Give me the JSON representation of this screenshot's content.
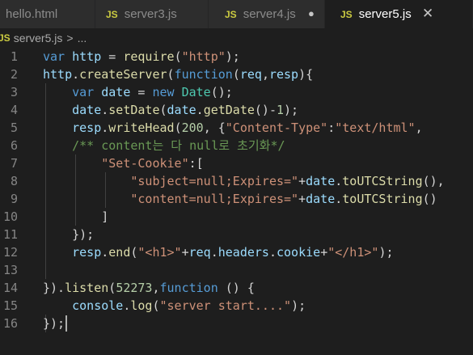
{
  "tabs": [
    {
      "label": "hello.html",
      "badge": "",
      "icon": "html-file-icon",
      "state": "inactive"
    },
    {
      "label": "server3.js",
      "badge": "JS",
      "icon": "js-file-icon",
      "state": "inactive"
    },
    {
      "label": "server4.js",
      "badge": "JS",
      "icon": "js-file-icon",
      "state": "inactive-modified",
      "indicator": "●"
    },
    {
      "label": "server5.js",
      "badge": "JS",
      "icon": "js-file-icon",
      "state": "active",
      "indicator": "✕"
    }
  ],
  "breadcrumb": {
    "badge": "JS",
    "file": "server5.js",
    "separator": ">",
    "more": "..."
  },
  "colors": {
    "editor_bg": "#1e1e1e",
    "tab_bar_bg": "#252526",
    "tab_inactive_bg": "#2d2d2d",
    "keyword": "#569cd6",
    "variable": "#9cdcfe",
    "function": "#dcdcaa",
    "string": "#ce9178",
    "number": "#b5cea8",
    "comment": "#6a9955",
    "js_badge": "#cbcb41"
  },
  "editor": {
    "line_numbers": [
      "1",
      "2",
      "3",
      "4",
      "5",
      "6",
      "7",
      "8",
      "9",
      "10",
      "11",
      "12",
      "13",
      "14",
      "15",
      "16"
    ],
    "lines": [
      [
        [
          "k",
          "var"
        ],
        [
          "p",
          " "
        ],
        [
          "v",
          "http"
        ],
        [
          "p",
          " = "
        ],
        [
          "f",
          "require"
        ],
        [
          "p",
          "("
        ],
        [
          "s",
          "\"http\""
        ],
        [
          "p",
          ");"
        ]
      ],
      [
        [
          "v",
          "http"
        ],
        [
          "p",
          "."
        ],
        [
          "f",
          "createServer"
        ],
        [
          "p",
          "("
        ],
        [
          "k",
          "function"
        ],
        [
          "p",
          "("
        ],
        [
          "v",
          "req"
        ],
        [
          "p",
          ","
        ],
        [
          "v",
          "resp"
        ],
        [
          "p",
          "){"
        ]
      ],
      [
        [
          "p",
          "    "
        ],
        [
          "k",
          "var"
        ],
        [
          "p",
          " "
        ],
        [
          "v",
          "date"
        ],
        [
          "p",
          " = "
        ],
        [
          "k",
          "new"
        ],
        [
          "p",
          " "
        ],
        [
          "t",
          "Date"
        ],
        [
          "p",
          "();"
        ]
      ],
      [
        [
          "p",
          "    "
        ],
        [
          "v",
          "date"
        ],
        [
          "p",
          "."
        ],
        [
          "f",
          "setDate"
        ],
        [
          "p",
          "("
        ],
        [
          "v",
          "date"
        ],
        [
          "p",
          "."
        ],
        [
          "f",
          "getDate"
        ],
        [
          "p",
          "()-"
        ],
        [
          "n",
          "1"
        ],
        [
          "p",
          ");"
        ]
      ],
      [
        [
          "p",
          "    "
        ],
        [
          "v",
          "resp"
        ],
        [
          "p",
          "."
        ],
        [
          "f",
          "writeHead"
        ],
        [
          "p",
          "("
        ],
        [
          "n",
          "200"
        ],
        [
          "p",
          ", {"
        ],
        [
          "s",
          "\"Content-Type\""
        ],
        [
          "p",
          ":"
        ],
        [
          "s",
          "\"text/html\""
        ],
        [
          "p",
          ","
        ]
      ],
      [
        [
          "p",
          "    "
        ],
        [
          "c",
          "/** content는 다 null로 초기화*/"
        ]
      ],
      [
        [
          "p",
          "        "
        ],
        [
          "s",
          "\"Set-Cookie\""
        ],
        [
          "p",
          ":["
        ]
      ],
      [
        [
          "p",
          "            "
        ],
        [
          "s",
          "\"subject=null;Expires=\""
        ],
        [
          "p",
          "+"
        ],
        [
          "v",
          "date"
        ],
        [
          "p",
          "."
        ],
        [
          "f",
          "toUTCString"
        ],
        [
          "p",
          "(),"
        ]
      ],
      [
        [
          "p",
          "            "
        ],
        [
          "s",
          "\"content=null;Expires=\""
        ],
        [
          "p",
          "+"
        ],
        [
          "v",
          "date"
        ],
        [
          "p",
          "."
        ],
        [
          "f",
          "toUTCString"
        ],
        [
          "p",
          "()"
        ]
      ],
      [
        [
          "p",
          "        ]"
        ]
      ],
      [
        [
          "p",
          "    });"
        ]
      ],
      [
        [
          "p",
          "    "
        ],
        [
          "v",
          "resp"
        ],
        [
          "p",
          "."
        ],
        [
          "f",
          "end"
        ],
        [
          "p",
          "("
        ],
        [
          "s",
          "\"<h1>\""
        ],
        [
          "p",
          "+"
        ],
        [
          "v",
          "req"
        ],
        [
          "p",
          "."
        ],
        [
          "v",
          "headers"
        ],
        [
          "p",
          "."
        ],
        [
          "v",
          "cookie"
        ],
        [
          "p",
          "+"
        ],
        [
          "s",
          "\"</h1>\""
        ],
        [
          "p",
          ");"
        ]
      ],
      [],
      [
        [
          "p",
          "})."
        ],
        [
          "f",
          "listen"
        ],
        [
          "p",
          "("
        ],
        [
          "n",
          "52273"
        ],
        [
          "p",
          ","
        ],
        [
          "k",
          "function"
        ],
        [
          "p",
          " () {"
        ]
      ],
      [
        [
          "p",
          "    "
        ],
        [
          "v",
          "console"
        ],
        [
          "p",
          "."
        ],
        [
          "f",
          "log"
        ],
        [
          "p",
          "("
        ],
        [
          "s",
          "\"server start....\""
        ],
        [
          "p",
          ");"
        ]
      ],
      [
        [
          "p",
          "});"
        ]
      ]
    ]
  }
}
